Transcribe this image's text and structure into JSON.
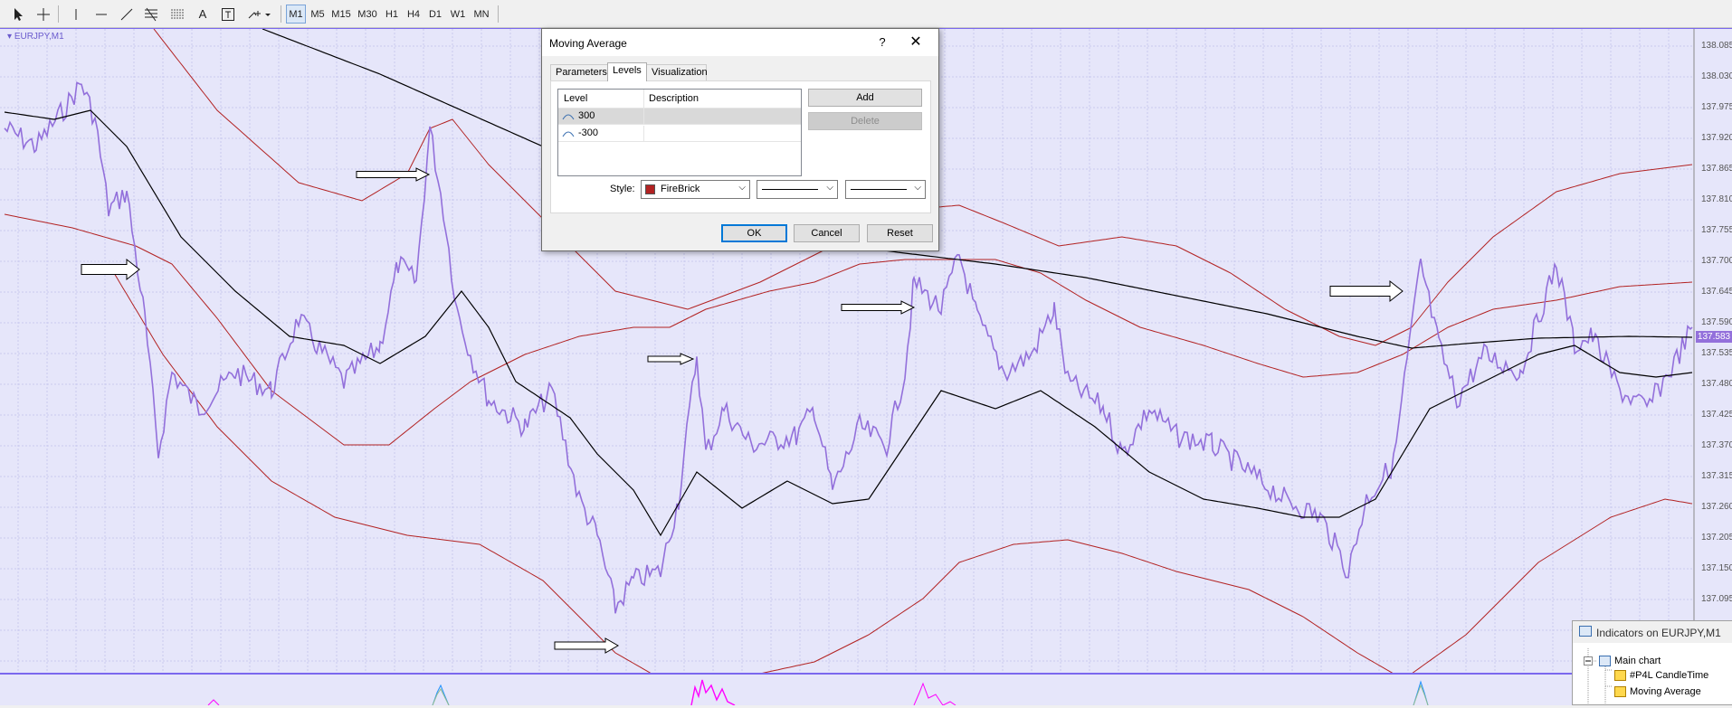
{
  "toolbar": {
    "icons": [
      "cursor-icon",
      "crosshair-icon",
      "vertical-line-icon",
      "horizontal-line-icon",
      "trendline-icon",
      "fibonacci-icon",
      "channel-icon",
      "text-icon",
      "text-label-icon",
      "arrows-icon"
    ],
    "text_tool": "A",
    "timeframes": [
      "M1",
      "M5",
      "M15",
      "M30",
      "H1",
      "H4",
      "D1",
      "W1",
      "MN"
    ],
    "active_timeframe": "M1"
  },
  "chart": {
    "symbol": "EURJPY,M1",
    "price_axis": [
      "138.085",
      "138.030",
      "137.975",
      "137.920",
      "137.865",
      "137.810",
      "137.755",
      "137.700",
      "137.645",
      "137.590",
      "137.535",
      "137.480",
      "137.425",
      "137.370",
      "137.315",
      "137.260",
      "137.205",
      "137.150",
      "137.095"
    ],
    "current_price": "137.583",
    "colors": {
      "background": "#e6e6fa",
      "price": "#9370db",
      "ma": "#000000",
      "band": "#b22222",
      "sub_indicator": "#ff00ff"
    }
  },
  "dialog": {
    "title": "Moving Average",
    "help": "?",
    "close": "✕",
    "tabs": [
      "Parameters",
      "Levels",
      "Visualization"
    ],
    "active_tab": "Levels",
    "columns": {
      "level": "Level",
      "description": "Description"
    },
    "levels": [
      {
        "value": "300",
        "description": ""
      },
      {
        "value": "-300",
        "description": ""
      }
    ],
    "add_label": "Add",
    "delete_label": "Delete",
    "style_label": "Style:",
    "color_name": "FireBrick",
    "buttons": {
      "ok": "OK",
      "cancel": "Cancel",
      "reset": "Reset"
    }
  },
  "indicators_panel": {
    "title": "Indicators on EURJPY,M1",
    "tree": {
      "main": "Main chart",
      "items": [
        "#P4L CandleTime",
        "Moving Average"
      ]
    }
  }
}
